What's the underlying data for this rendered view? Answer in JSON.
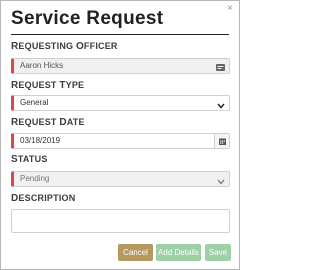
{
  "dialog": {
    "title": "Service Request",
    "close_label": "×"
  },
  "requesting_officer": {
    "label_first": "R",
    "label_rest": "EQUESTING ",
    "label_first2": "O",
    "label_rest2": "FFICER",
    "value": "Aaron Hicks",
    "icon": "id-card-icon"
  },
  "request_type": {
    "label_first": "R",
    "label_rest": "EQUEST ",
    "label_first2": "T",
    "label_rest2": "YPE",
    "value": "General",
    "icon": "chevron-down-icon"
  },
  "request_date": {
    "label_first": "R",
    "label_rest": "EQUEST ",
    "label_first2": "D",
    "label_rest2": "ATE",
    "value": "03/18/2019",
    "icon": "calendar-icon"
  },
  "status": {
    "label_first": "S",
    "label_rest": "TATUS",
    "value": "Pending",
    "icon": "chevron-down-icon"
  },
  "description": {
    "label_first": "D",
    "label_rest": "ESCRIPTION",
    "value": ""
  },
  "buttons": {
    "cancel": "Cancel",
    "add_details": "Add Details",
    "save": "Save"
  },
  "colors": {
    "required_marker": "#d9484a",
    "cancel_button": "#b5995f",
    "primary_button": "#9ed0a5"
  }
}
